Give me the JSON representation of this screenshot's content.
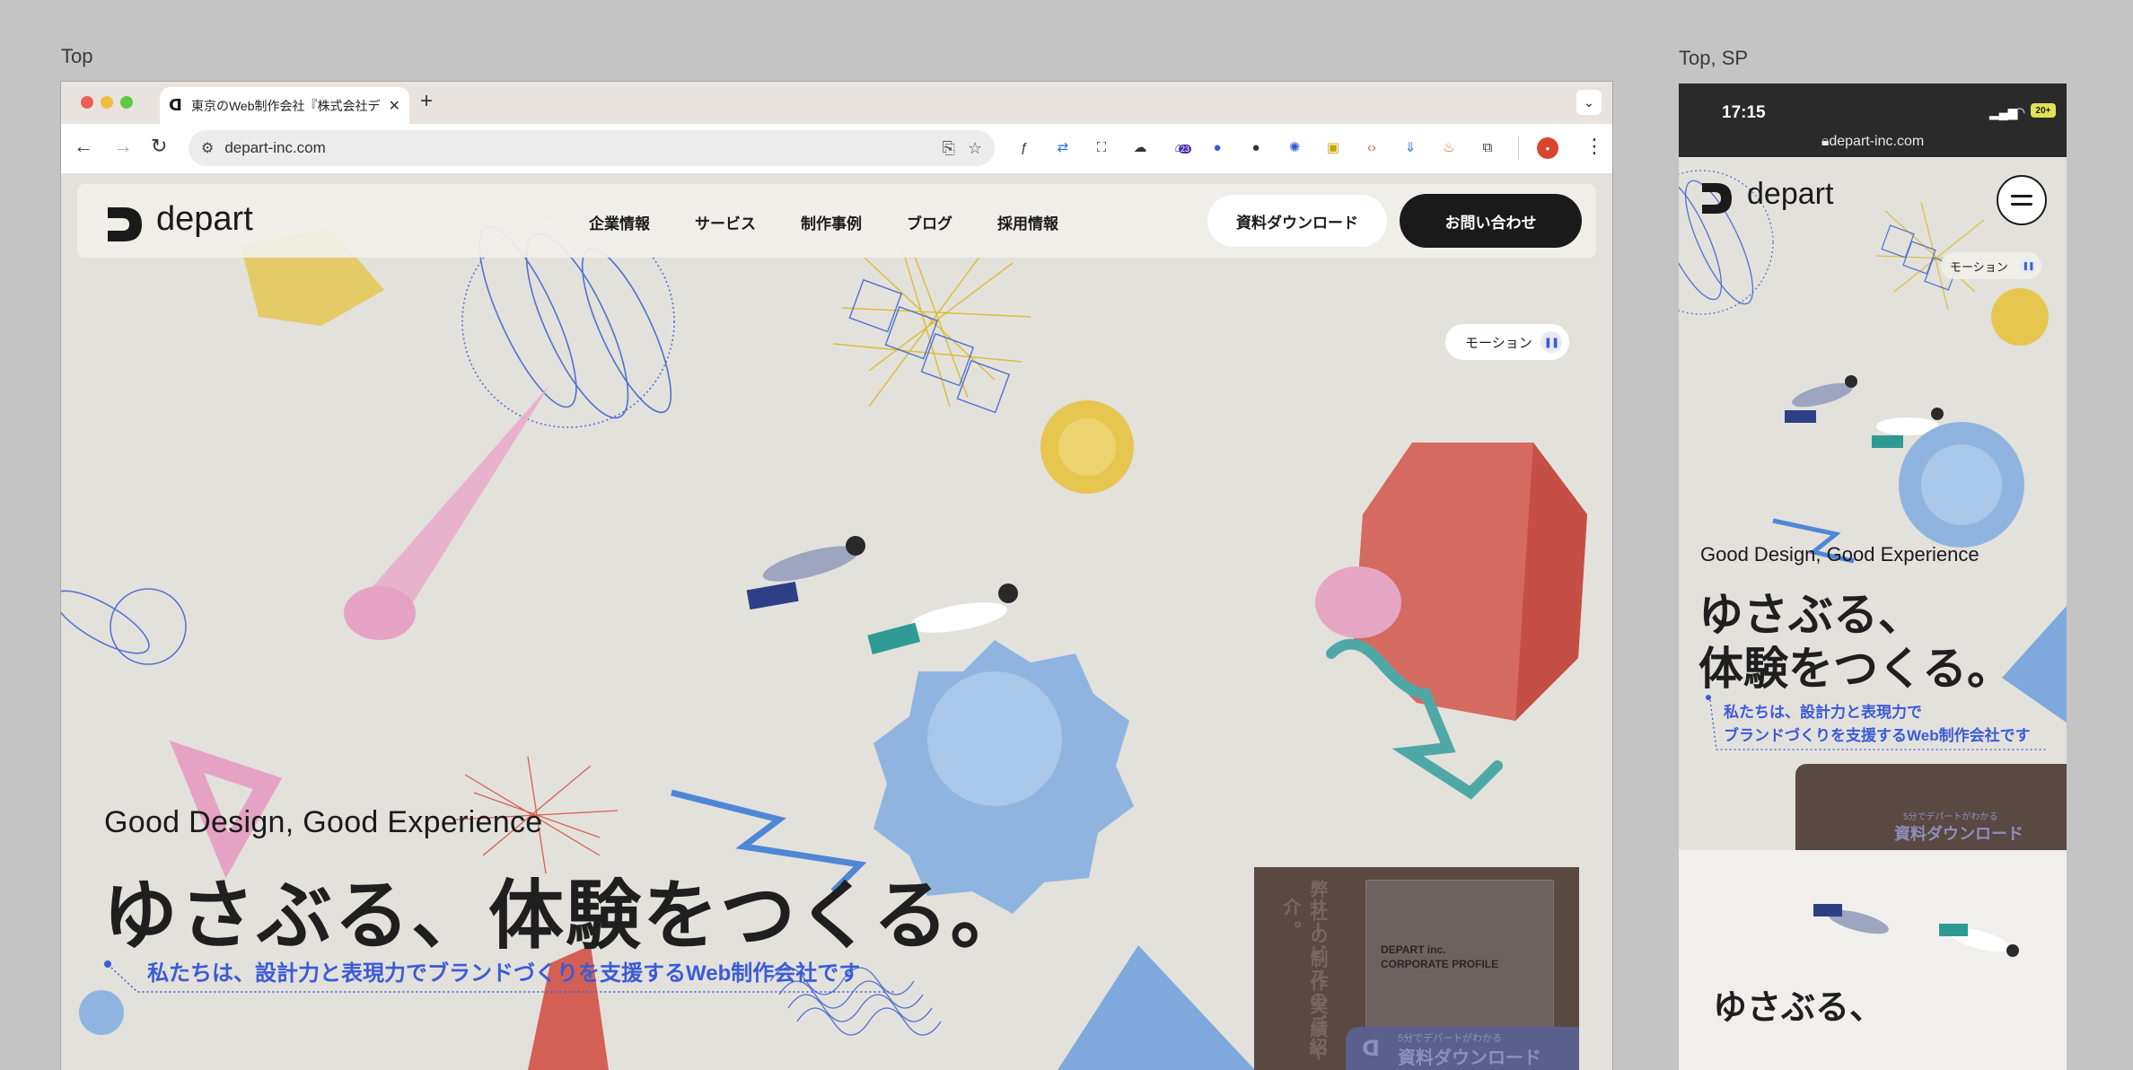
{
  "frames": {
    "desktop_label": "Top",
    "mobile_label": "Top, SP"
  },
  "browser": {
    "tab_title": "東京のWeb制作会社『株式会社デ",
    "tab_close": "✕",
    "new_tab": "+",
    "url": "depart-inc.com",
    "extension_badge": "23",
    "extension_icons": [
      "function-icon",
      "translate-icon",
      "screenshot-icon",
      "bird-icon",
      "badge-extension-icon",
      "blue-circle-icon",
      "black-circle-icon",
      "network-icon",
      "image-icon",
      "code-icon",
      "download-icon",
      "fire-icon",
      "puzzle-icon"
    ]
  },
  "site": {
    "logo": "depart",
    "nav": [
      "企業情報",
      "サービス",
      "制作事例",
      "ブログ",
      "採用情報"
    ],
    "download_button": "資料ダウンロード",
    "contact_button": "お問い合わせ",
    "motion_label": "モーション",
    "hero_sub": "Good Design, Good Experience",
    "hero_main": "ゆさぶる、体験をつくる。",
    "hero_desc": "私たちは、設計力と表現力でブランドづくりを支援するWeb制作会社です",
    "promo": {
      "vertical_1": "弊社の制作実績や",
      "vertical_2": "サービスのご紹介。",
      "card_line_1": "DEPART inc.",
      "card_line_2": "CORPORATE PROFILE",
      "bar_small": "5分でデパートがわかる",
      "bar_large": "資料ダウンロード"
    }
  },
  "mobile": {
    "time": "17:15",
    "battery": "20+",
    "url": "depart-inc.com",
    "logo": "depart",
    "motion_label": "モーション",
    "hero_sub": "Good Design, Good Experience",
    "hero_main_line1": "ゆさぶる、",
    "hero_main_line2": "体験をつくる。",
    "hero_desc_line1": "私たちは、設計力と表現力で",
    "hero_desc_line2": "ブランドづくりを支援するWeb制作会社です",
    "promo_small": "5分でデパートがわかる",
    "promo_large": "資料ダウンロード",
    "section_heading": "ゆさぶる、"
  },
  "colors": {
    "accent_blue": "#3b5bd6",
    "dark": "#1a1a1a",
    "page_bg": "#e3e1dc"
  }
}
